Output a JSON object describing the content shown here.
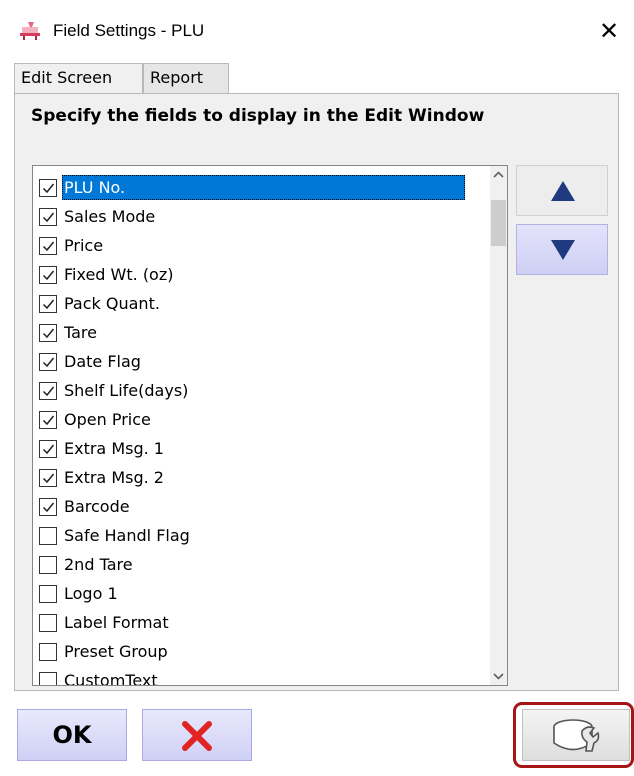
{
  "window": {
    "title": "Field Settings - PLU",
    "close_label": "✕"
  },
  "tabs": [
    {
      "label": "Edit Screen",
      "active": true
    },
    {
      "label": "Report",
      "active": false
    }
  ],
  "panel": {
    "heading": "Specify the fields to display in the Edit Window"
  },
  "fields": [
    {
      "label": "PLU No.",
      "checked": true,
      "selected": true
    },
    {
      "label": "Sales Mode",
      "checked": true
    },
    {
      "label": "Price",
      "checked": true
    },
    {
      "label": "Fixed Wt. (oz)",
      "checked": true
    },
    {
      "label": "Pack Quant.",
      "checked": true
    },
    {
      "label": "Tare",
      "checked": true
    },
    {
      "label": "Date Flag",
      "checked": true
    },
    {
      "label": "Shelf Life(days)",
      "checked": true
    },
    {
      "label": "Open Price",
      "checked": true
    },
    {
      "label": "Extra Msg. 1",
      "checked": true
    },
    {
      "label": "Extra Msg. 2",
      "checked": true
    },
    {
      "label": "Barcode",
      "checked": true
    },
    {
      "label": "Safe Handl Flag",
      "checked": false
    },
    {
      "label": "2nd Tare",
      "checked": false
    },
    {
      "label": "Logo 1",
      "checked": false
    },
    {
      "label": "Label Format",
      "checked": false
    },
    {
      "label": "Preset Group",
      "checked": false
    },
    {
      "label": "CustomText",
      "checked": false
    }
  ],
  "buttons": {
    "ok_label": "OK",
    "move_up_icon": "triangle-up-icon",
    "move_down_icon": "triangle-down-icon",
    "cancel_icon": "red-x-icon",
    "tools_icon": "wrench-icon"
  },
  "colors": {
    "selection": "#0078d7",
    "highlight_border": "#a51515",
    "arrow": "#1f3a80",
    "cancel_x": "#e02424"
  }
}
